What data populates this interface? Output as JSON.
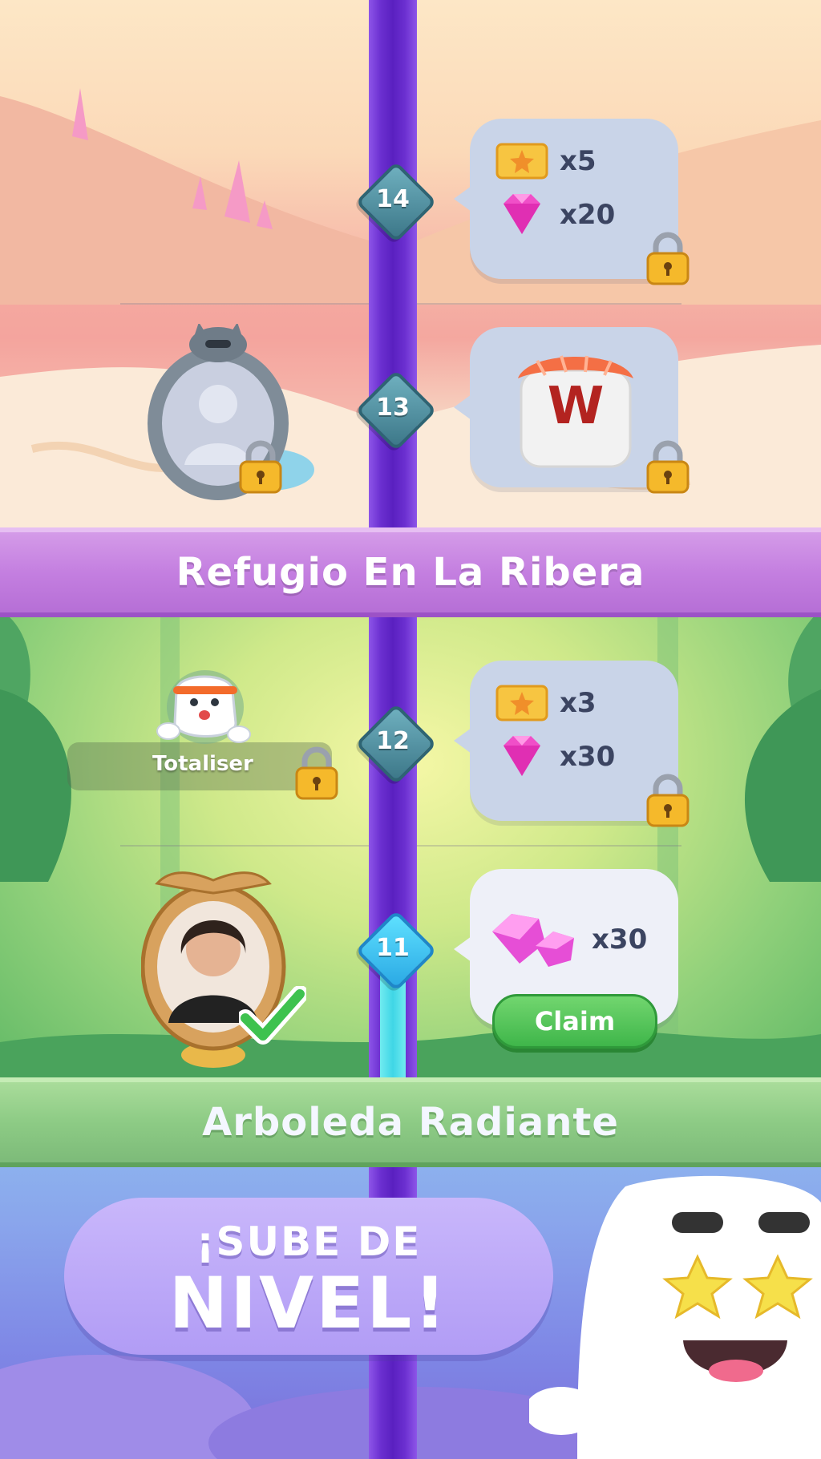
{
  "levels": [
    {
      "number": "14",
      "state": "locked",
      "rewards": [
        {
          "icon": "ticket-icon",
          "count": "x5"
        },
        {
          "icon": "gem-icon",
          "count": "x20"
        }
      ]
    },
    {
      "number": "13",
      "state": "locked",
      "reward_tile_letter": "W"
    },
    {
      "number": "12",
      "state": "locked",
      "rewards": [
        {
          "icon": "ticket-icon",
          "count": "x3"
        },
        {
          "icon": "gem-icon",
          "count": "x30"
        }
      ],
      "sticker_label": "Totaliser"
    },
    {
      "number": "11",
      "state": "completed",
      "rewards": [
        {
          "icon": "gem-pile-icon",
          "count": "x30"
        }
      ],
      "claim_label": "Claim"
    }
  ],
  "areas": {
    "riverbank": "Refugio En La Ribera",
    "grove": "Arboleda Radiante"
  },
  "promo": {
    "line1": "¡SUBE DE",
    "line2": "NIVEL!"
  },
  "colors": {
    "track": "#6b2fd0",
    "track_completed": "#3fd6e6",
    "claim_green": "#3fb64a",
    "bubble_locked": "#c9d4e8",
    "banner_purple": "#c47fe0",
    "banner_green": "#8dcb85"
  }
}
